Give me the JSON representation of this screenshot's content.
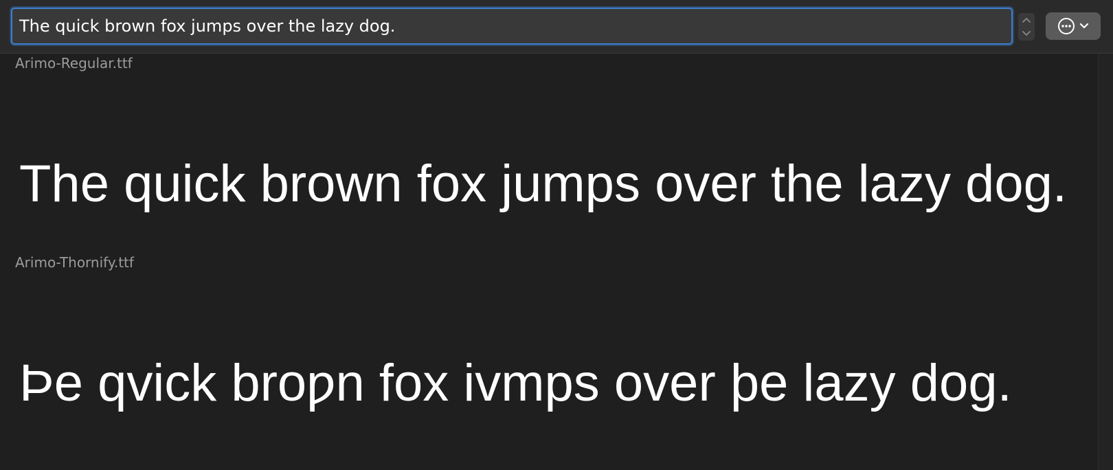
{
  "search": {
    "value": "The quick brown fox jumps over the lazy dog."
  },
  "toolbar": {
    "stepper_up_icon": "chevron-up-icon",
    "stepper_down_icon": "chevron-down-icon",
    "more_icon": "ellipsis-circle-icon",
    "more_chevron_icon": "chevron-down-icon"
  },
  "fonts": [
    {
      "file": "Arimo-Regular.ttf",
      "sample": "The quick brown fox jumps over the lazy dog."
    },
    {
      "file": "Arimo-Thornify.ttf",
      "sample": "Þe qvick broƿn fox ivmps over þe lazy dog."
    }
  ],
  "colors": {
    "accent": "#3d7fcf",
    "background": "#1f1f1f",
    "toolbar": "#2a2a2a"
  }
}
